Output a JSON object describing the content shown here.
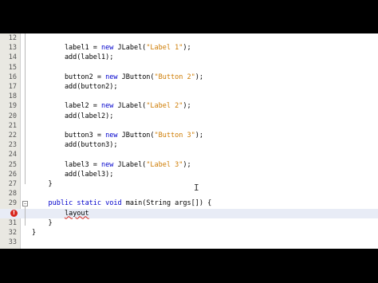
{
  "editor": {
    "lines": [
      {
        "n": "12",
        "text": ""
      },
      {
        "n": "13",
        "text": "        label1 = new JLabel(\"Label 1\");"
      },
      {
        "n": "14",
        "text": "        add(label1);"
      },
      {
        "n": "15",
        "text": ""
      },
      {
        "n": "16",
        "text": "        button2 = new JButton(\"Button 2\");"
      },
      {
        "n": "17",
        "text": "        add(button2);"
      },
      {
        "n": "18",
        "text": ""
      },
      {
        "n": "19",
        "text": "        label2 = new JLabel(\"Label 2\");"
      },
      {
        "n": "20",
        "text": "        add(label2);"
      },
      {
        "n": "21",
        "text": ""
      },
      {
        "n": "22",
        "text": "        button3 = new JButton(\"Button 3\");"
      },
      {
        "n": "23",
        "text": "        add(button3);"
      },
      {
        "n": "24",
        "text": ""
      },
      {
        "n": "25",
        "text": "        label3 = new JLabel(\"Label 3\");"
      },
      {
        "n": "26",
        "text": "        add(label3);"
      },
      {
        "n": "27",
        "text": "    }"
      },
      {
        "n": "28",
        "text": ""
      },
      {
        "n": "29",
        "text": "    public static void main(String args[]) {"
      },
      {
        "n": "30",
        "text": "        layout"
      },
      {
        "n": "31",
        "text": "    }"
      },
      {
        "n": "32",
        "text": "}"
      },
      {
        "n": "33",
        "text": ""
      }
    ],
    "error_marker": "!",
    "current_line": "30",
    "error_line": "30"
  }
}
